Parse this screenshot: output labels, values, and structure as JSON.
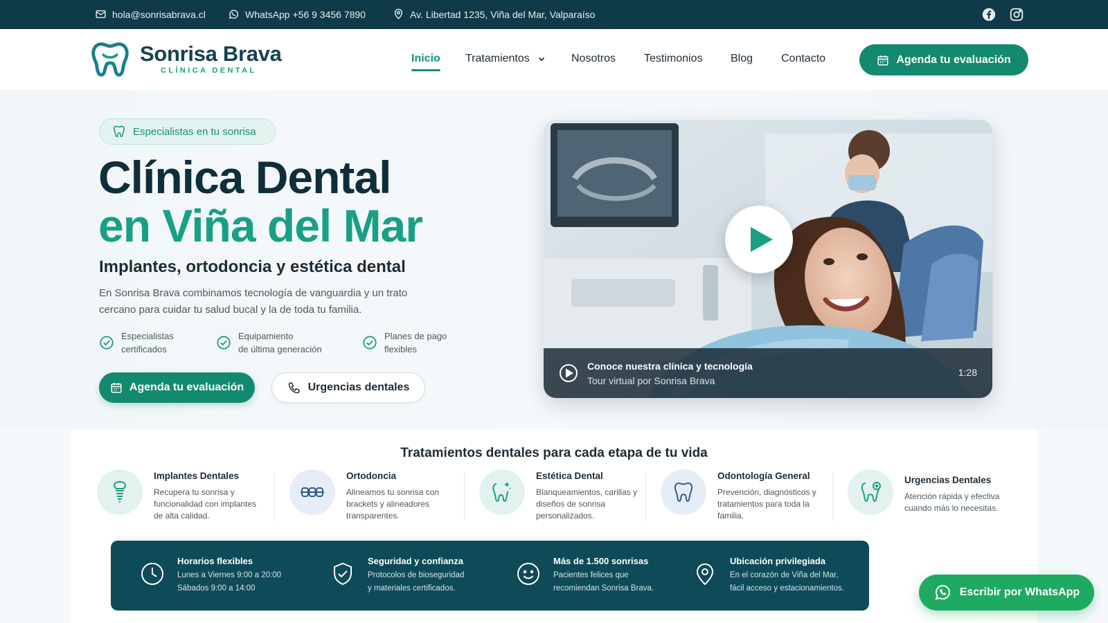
{
  "topbar": {
    "email": "hola@sonrisabrava.cl",
    "whatsapp": "WhatsApp +56 9 3456 7890",
    "address": "Av. Libertad 1235, Viña del Mar, Valparaíso",
    "social": [
      "facebook-icon",
      "instagram-icon"
    ]
  },
  "brand": {
    "name": "Sonrisa Brava",
    "tagline": "CLÍNICA DENTAL",
    "accent": "#18a085",
    "dark": "#0f3a47"
  },
  "nav": {
    "items": [
      "Inicio",
      "Tratamientos",
      "Nosotros",
      "Testimonios",
      "Blog",
      "Contacto"
    ],
    "active": "Inicio",
    "cta": "Agenda tu evaluación"
  },
  "hero": {
    "badge": "Especialistas en tu sonrisa",
    "title_line1": "Clínica Dental",
    "title_line2": "en Viña del Mar",
    "subtitle": "Implantes, ortodoncia y estética dental",
    "lead": "En Sonrisa Brava combinamos tecnología de vanguardia y un trato cercano para cuidar tu salud bucal y la de toda tu familia.",
    "features": [
      {
        "line1": "Especialistas",
        "line2": "certificados"
      },
      {
        "line1": "Equipamiento",
        "line2": "de última generación"
      },
      {
        "line1": "Planes de pago",
        "line2": "flexibles"
      }
    ],
    "primary_button": "Agenda tu evaluación",
    "secondary_button": "Urgencias dentales"
  },
  "video": {
    "title": "Conoce nuestra clínica y tecnología",
    "subtitle": "Tour virtual por Sonrisa Brava",
    "duration": "1:28"
  },
  "treatments": {
    "heading": "Tratamientos dentales para cada etapa de tu vida",
    "items": [
      {
        "title": "Implantes Dentales",
        "desc": "Recupera tu sonrisa y funcionalidad con implantes de alta calidad.",
        "icon": "implant-icon"
      },
      {
        "title": "Ortodoncia",
        "desc": "Alineamos tu sonrisa con brackets y alineadores transparentes.",
        "icon": "braces-icon"
      },
      {
        "title": "Estética Dental",
        "desc": "Blanqueamientos, carillas y diseños de sonrisa personalizados.",
        "icon": "sparkle-tooth-icon"
      },
      {
        "title": "Odontología General",
        "desc": "Prevención, diagnósticos y tratamientos para toda la familia.",
        "icon": "tooth-icon"
      },
      {
        "title": "Urgencias Dentales",
        "desc": "Atención rápida y efectiva cuando más lo necesitas.",
        "icon": "emergency-tooth-icon"
      }
    ]
  },
  "info_band": [
    {
      "title": "Horarios flexibles",
      "line1": "Lunes a Viernes 9:00 a 20:00",
      "line2": "Sábados 9:00 a 14:00",
      "icon": "clock-icon"
    },
    {
      "title": "Seguridad y confianza",
      "line1": "Protocolos de bioseguridad",
      "line2": "y materiales certificados.",
      "icon": "shield-icon"
    },
    {
      "title": "Más de 1.500 sonrisas",
      "line1": "Pacientes felices que",
      "line2": "recomiendan Sonrisa Brava.",
      "icon": "smile-icon"
    },
    {
      "title": "Ubicación privilegiada",
      "line1": "En el corazón de Viña del Mar,",
      "line2": "fácil acceso y estacionamientos.",
      "icon": "location-pin-icon"
    }
  ],
  "whatsapp_button": "Escribir por WhatsApp"
}
